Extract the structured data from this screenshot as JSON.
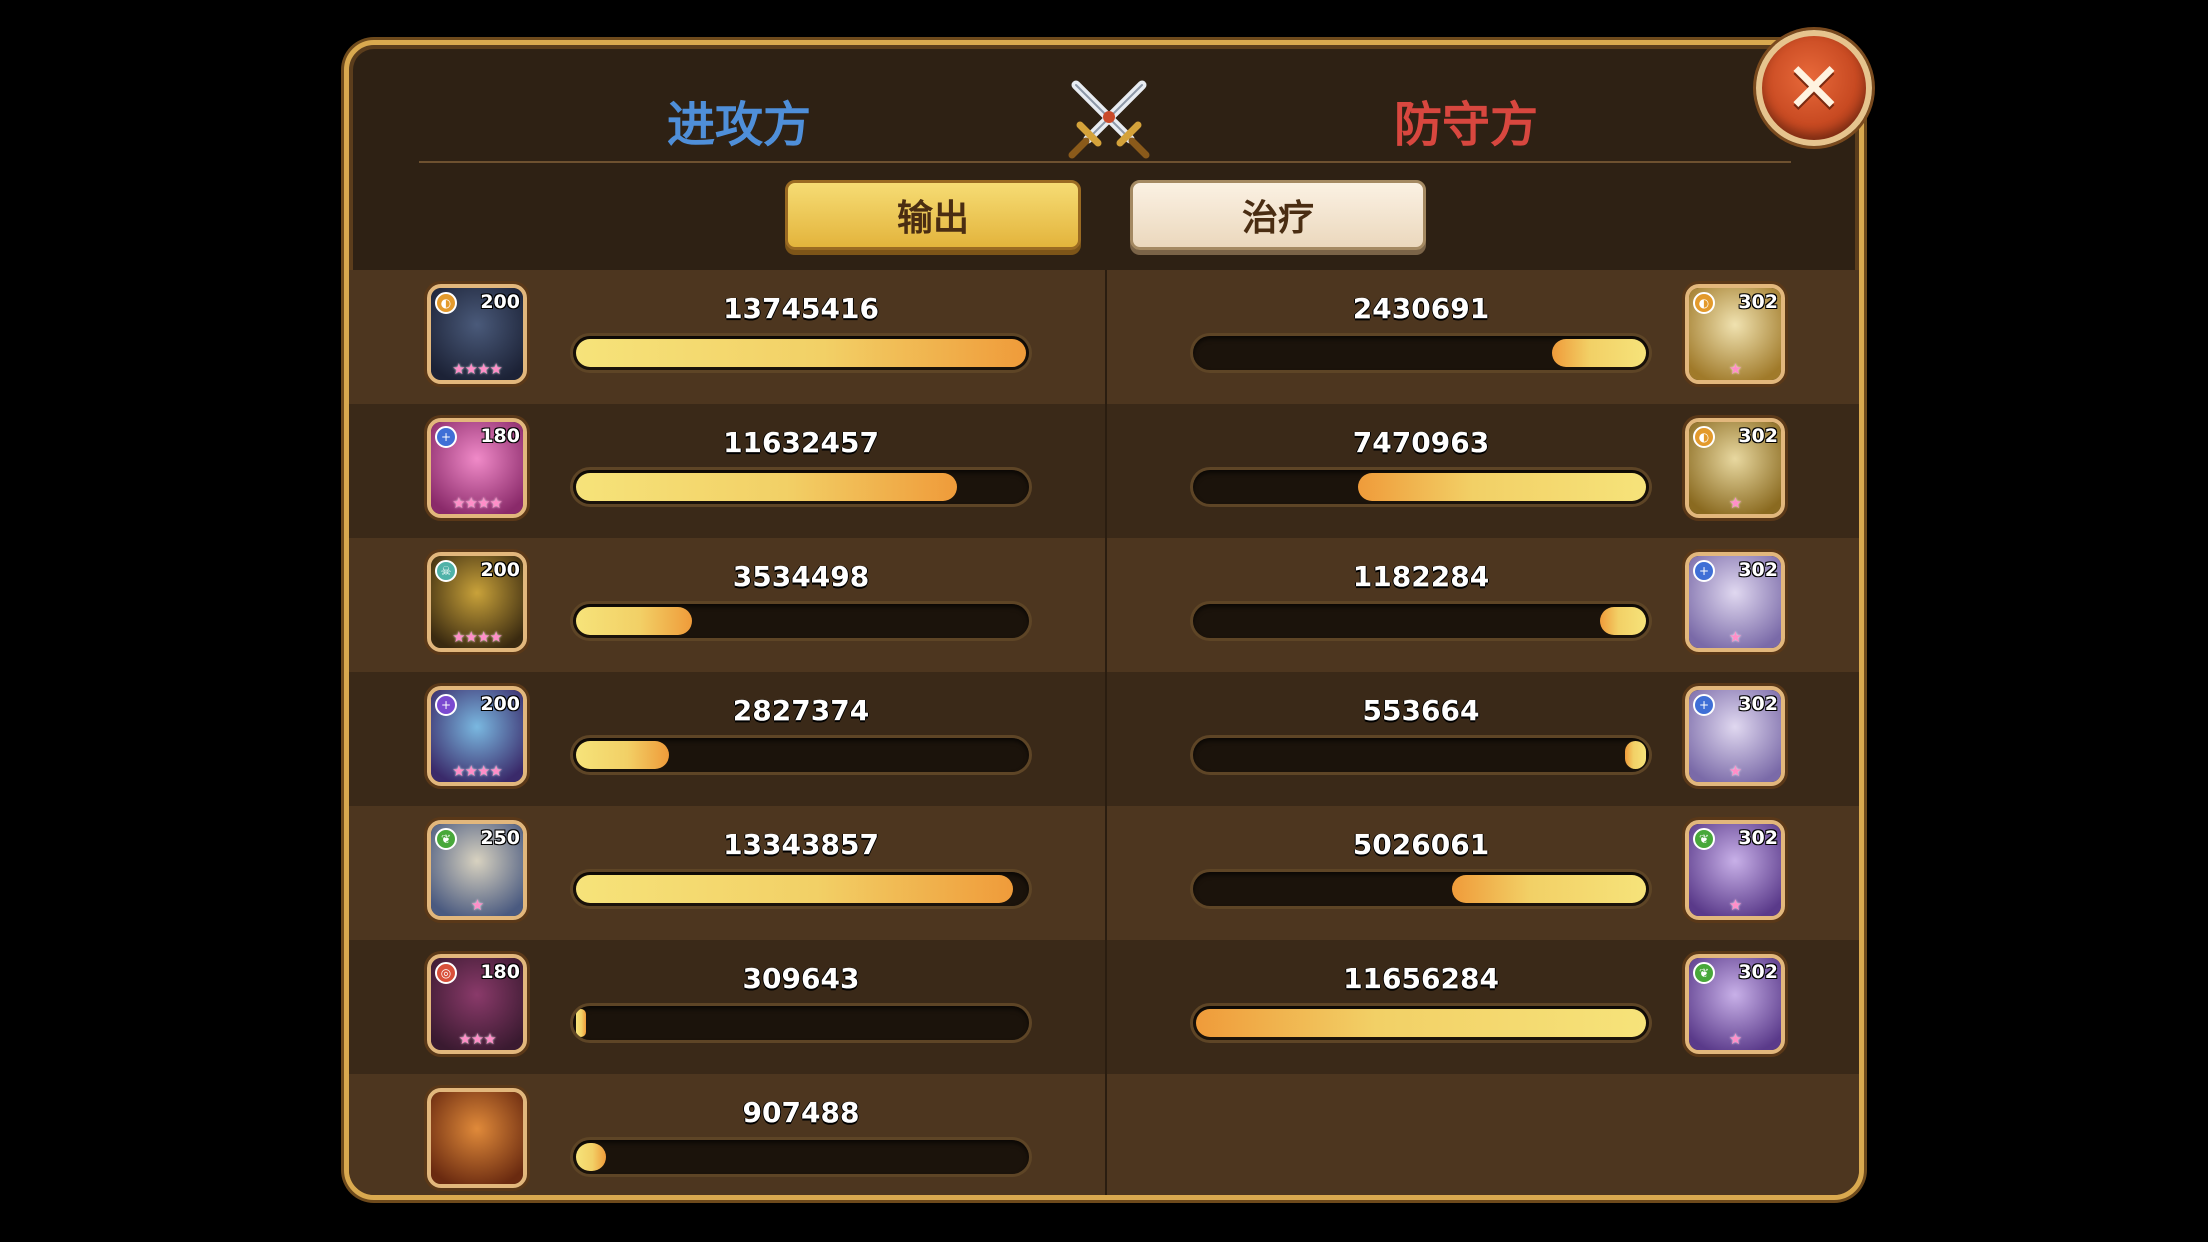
{
  "header": {
    "attacker_title": "进攻方",
    "defender_title": "防守方",
    "center_icon": "crossed-swords-icon",
    "close_icon": "close-icon"
  },
  "tabs": [
    {
      "label": "输出",
      "active": true
    },
    {
      "label": "治疗",
      "active": false
    }
  ],
  "attackers": [
    {
      "value": "13745416",
      "amount": 13745416,
      "level": "200",
      "element": "light",
      "stars": 4,
      "portrait": "dark-armored-demon"
    },
    {
      "value": "11632457",
      "amount": 11632457,
      "level": "180",
      "element": "forest-cross",
      "stars": 4,
      "portrait": "pink-haired-witch"
    },
    {
      "value": "3534498",
      "amount": 3534498,
      "level": "200",
      "element": "skull",
      "stars": 4,
      "portrait": "golden-horned-knight"
    },
    {
      "value": "2827374",
      "amount": 2827374,
      "level": "200",
      "element": "shadow",
      "stars": 4,
      "portrait": "blue-skinned-demon"
    },
    {
      "value": "13343857",
      "amount": 13343857,
      "level": "250",
      "element": "nature",
      "stars": 1,
      "portrait": "silver-haired-warrior"
    },
    {
      "value": "309643",
      "amount": 309643,
      "level": "180",
      "element": "fire",
      "stars": 3,
      "portrait": "purple-horned-beast"
    },
    {
      "value": "907488",
      "amount": 907488,
      "level": "",
      "element": "",
      "stars": 0,
      "portrait": "orange-ogre"
    }
  ],
  "defenders": [
    {
      "value": "2430691",
      "amount": 2430691,
      "level": "302",
      "element": "light",
      "stars": 1,
      "portrait": "golden-hooded-paladin"
    },
    {
      "value": "7470963",
      "amount": 7470963,
      "level": "302",
      "element": "light",
      "stars": 1,
      "portrait": "golden-crystal-guardian"
    },
    {
      "value": "1182284",
      "amount": 1182284,
      "level": "302",
      "element": "forest-cross",
      "stars": 1,
      "portrait": "white-robed-priestess"
    },
    {
      "value": "553664",
      "amount": 553664,
      "level": "302",
      "element": "forest-cross",
      "stars": 1,
      "portrait": "white-robed-priestess"
    },
    {
      "value": "5026061",
      "amount": 5026061,
      "level": "302",
      "element": "nature",
      "stars": 1,
      "portrait": "lavender-haired-sorceress"
    },
    {
      "value": "11656284",
      "amount": 11656284,
      "level": "302",
      "element": "nature",
      "stars": 1,
      "portrait": "lavender-haired-sorceress"
    }
  ],
  "colors": {
    "attacker": "#4f8fd9",
    "defender": "#d8473f",
    "bar_light": "#f6e37a",
    "bar_dark": "#ef9b3a"
  }
}
